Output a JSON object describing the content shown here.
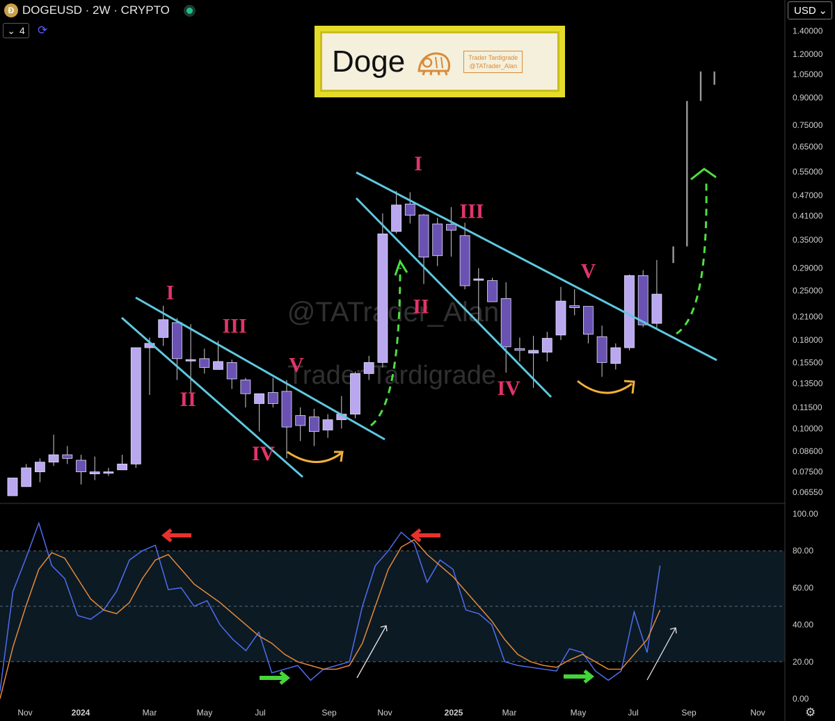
{
  "header": {
    "symbol_line": "DOGEUSD · 2W · CRYPTO",
    "collapsed_count": "4",
    "currency": "USD"
  },
  "logo": {
    "title": "Doge",
    "badge_line1": "Trader Tardigrade",
    "badge_line2": "@TATrader_Alan"
  },
  "watermarks": [
    "@TATrader_Alan",
    "Trader Tardigrade"
  ],
  "colors": {
    "candle_up": "#b9a7ef",
    "candle_down": "#6a52b3",
    "wedge_line": "#5ec8e0",
    "wave_label": "#e0356a",
    "projection": "#4de040",
    "arc": "#f2b03c",
    "stoch_k": "#4f6df0",
    "stoch_d": "#e58a3a",
    "band_fill": "#0c1a24",
    "arrow_red": "#e8322b",
    "arrow_green": "#45d43a"
  },
  "chart_data": [
    {
      "type": "candlestick",
      "title": "DOGEUSD · 2W · CRYPTO",
      "y_scale": "log",
      "ylim": [
        0.064,
        1.45
      ],
      "y_ticks": [
        "1.40000",
        "1.20000",
        "1.05000",
        "0.90000",
        "0.75000",
        "0.65000",
        "0.55000",
        "0.47000",
        "0.41000",
        "0.35000",
        "0.29000",
        "0.25000",
        "0.21000",
        "0.18000",
        "0.15500",
        "0.13500",
        "0.11500",
        "0.10000",
        "0.08600",
        "0.07500",
        "0.06550"
      ],
      "x_ticks": [
        "Nov",
        "2024",
        "Mar",
        "May",
        "Jul",
        "Sep",
        "Nov",
        "2025",
        "Mar",
        "May",
        "Jul",
        "Sep",
        "Nov"
      ],
      "candles": [
        {
          "o": 0.064,
          "h": 0.072,
          "l": 0.064,
          "c": 0.072
        },
        {
          "o": 0.068,
          "h": 0.079,
          "l": 0.068,
          "c": 0.077
        },
        {
          "o": 0.075,
          "h": 0.082,
          "l": 0.07,
          "c": 0.08
        },
        {
          "o": 0.08,
          "h": 0.096,
          "l": 0.078,
          "c": 0.084
        },
        {
          "o": 0.084,
          "h": 0.089,
          "l": 0.079,
          "c": 0.082
        },
        {
          "o": 0.081,
          "h": 0.084,
          "l": 0.069,
          "c": 0.075
        },
        {
          "o": 0.074,
          "h": 0.083,
          "l": 0.071,
          "c": 0.075
        },
        {
          "o": 0.075,
          "h": 0.077,
          "l": 0.073,
          "c": 0.075
        },
        {
          "o": 0.076,
          "h": 0.084,
          "l": 0.076,
          "c": 0.079
        },
        {
          "o": 0.079,
          "h": 0.154,
          "l": 0.077,
          "c": 0.171
        },
        {
          "o": 0.171,
          "h": 0.183,
          "l": 0.125,
          "c": 0.176
        },
        {
          "o": 0.183,
          "h": 0.226,
          "l": 0.173,
          "c": 0.206
        },
        {
          "o": 0.202,
          "h": 0.208,
          "l": 0.138,
          "c": 0.159
        },
        {
          "o": 0.158,
          "h": 0.2,
          "l": 0.127,
          "c": 0.158
        },
        {
          "o": 0.159,
          "h": 0.17,
          "l": 0.144,
          "c": 0.15
        },
        {
          "o": 0.148,
          "h": 0.179,
          "l": 0.148,
          "c": 0.156
        },
        {
          "o": 0.155,
          "h": 0.158,
          "l": 0.13,
          "c": 0.139
        },
        {
          "o": 0.138,
          "h": 0.14,
          "l": 0.115,
          "c": 0.126
        },
        {
          "o": 0.118,
          "h": 0.126,
          "l": 0.098,
          "c": 0.126
        },
        {
          "o": 0.127,
          "h": 0.14,
          "l": 0.115,
          "c": 0.118
        },
        {
          "o": 0.128,
          "h": 0.138,
          "l": 0.082,
          "c": 0.101
        },
        {
          "o": 0.109,
          "h": 0.115,
          "l": 0.092,
          "c": 0.102
        },
        {
          "o": 0.108,
          "h": 0.114,
          "l": 0.089,
          "c": 0.098
        },
        {
          "o": 0.099,
          "h": 0.11,
          "l": 0.094,
          "c": 0.106
        },
        {
          "o": 0.106,
          "h": 0.124,
          "l": 0.1,
          "c": 0.11
        },
        {
          "o": 0.11,
          "h": 0.146,
          "l": 0.107,
          "c": 0.144
        },
        {
          "o": 0.144,
          "h": 0.162,
          "l": 0.138,
          "c": 0.155
        },
        {
          "o": 0.155,
          "h": 0.417,
          "l": 0.15,
          "c": 0.364
        },
        {
          "o": 0.37,
          "h": 0.484,
          "l": 0.365,
          "c": 0.441
        },
        {
          "o": 0.444,
          "h": 0.48,
          "l": 0.39,
          "c": 0.412
        },
        {
          "o": 0.413,
          "h": 0.416,
          "l": 0.261,
          "c": 0.312
        },
        {
          "o": 0.389,
          "h": 0.405,
          "l": 0.294,
          "c": 0.315
        },
        {
          "o": 0.388,
          "h": 0.435,
          "l": 0.313,
          "c": 0.373
        },
        {
          "o": 0.36,
          "h": 0.392,
          "l": 0.252,
          "c": 0.258
        },
        {
          "o": 0.27,
          "h": 0.29,
          "l": 0.2,
          "c": 0.27
        },
        {
          "o": 0.267,
          "h": 0.272,
          "l": 0.232,
          "c": 0.232
        },
        {
          "o": 0.237,
          "h": 0.264,
          "l": 0.145,
          "c": 0.172
        },
        {
          "o": 0.17,
          "h": 0.183,
          "l": 0.156,
          "c": 0.168
        },
        {
          "o": 0.165,
          "h": 0.185,
          "l": 0.131,
          "c": 0.168
        },
        {
          "o": 0.166,
          "h": 0.19,
          "l": 0.156,
          "c": 0.182
        },
        {
          "o": 0.186,
          "h": 0.256,
          "l": 0.18,
          "c": 0.233
        },
        {
          "o": 0.226,
          "h": 0.252,
          "l": 0.212,
          "c": 0.223
        },
        {
          "o": 0.225,
          "h": 0.224,
          "l": 0.176,
          "c": 0.187
        },
        {
          "o": 0.184,
          "h": 0.198,
          "l": 0.141,
          "c": 0.155
        },
        {
          "o": 0.154,
          "h": 0.176,
          "l": 0.148,
          "c": 0.171
        },
        {
          "o": 0.171,
          "h": 0.278,
          "l": 0.168,
          "c": 0.276
        },
        {
          "o": 0.276,
          "h": 0.286,
          "l": 0.196,
          "c": 0.199
        },
        {
          "o": 0.201,
          "h": 0.306,
          "l": 0.195,
          "c": 0.244
        }
      ],
      "projection_bars": [
        {
          "low": 0.3,
          "high": 0.335
        },
        {
          "low": 0.335,
          "high": 0.88
        },
        {
          "low": 0.88,
          "high": 1.07
        },
        {
          "low": 0.98,
          "high": 1.07
        }
      ],
      "wave_labels": [
        {
          "text": "I",
          "x_index": 11.5,
          "price": 0.236
        },
        {
          "text": "II",
          "x_index": 12.8,
          "price": 0.116
        },
        {
          "text": "III",
          "x_index": 16.2,
          "price": 0.189
        },
        {
          "text": "IV",
          "x_index": 18.3,
          "price": 0.081
        },
        {
          "text": "V",
          "x_index": 20.7,
          "price": 0.146
        },
        {
          "text": "I",
          "x_index": 29.6,
          "price": 0.555
        },
        {
          "text": "II",
          "x_index": 29.8,
          "price": 0.215
        },
        {
          "text": "III",
          "x_index": 33.5,
          "price": 0.405
        },
        {
          "text": "IV",
          "x_index": 36.2,
          "price": 0.125
        },
        {
          "text": "V",
          "x_index": 42.0,
          "price": 0.272
        }
      ]
    },
    {
      "type": "line",
      "name": "Stochastic",
      "ylim": [
        0,
        100
      ],
      "y_ticks": [
        "100.00",
        "80.00",
        "60.00",
        "40.00",
        "20.00",
        "0.00"
      ],
      "bands": [
        20,
        50,
        80
      ],
      "series": [
        {
          "values": [
            4,
            58,
            76,
            95,
            72,
            65,
            45,
            43,
            48,
            58,
            75,
            80,
            83,
            59,
            60,
            50,
            53,
            40,
            32,
            26,
            36,
            14,
            16,
            18,
            10,
            16,
            18,
            20,
            50,
            72,
            80,
            90,
            84,
            63,
            75,
            70,
            48,
            46,
            40,
            20,
            18,
            17,
            16,
            15,
            27,
            25,
            15,
            10,
            15,
            47,
            25,
            72
          ]
        },
        {
          "values": [
            0,
            28,
            50,
            70,
            79,
            76,
            65,
            54,
            48,
            46,
            52,
            65,
            75,
            78,
            70,
            62,
            57,
            52,
            46,
            40,
            34,
            30,
            24,
            20,
            18,
            16,
            16,
            18,
            30,
            50,
            70,
            82,
            86,
            78,
            72,
            66,
            58,
            50,
            42,
            32,
            24,
            20,
            18,
            17,
            21,
            24,
            20,
            16,
            16,
            24,
            32,
            48
          ]
        }
      ]
    }
  ]
}
